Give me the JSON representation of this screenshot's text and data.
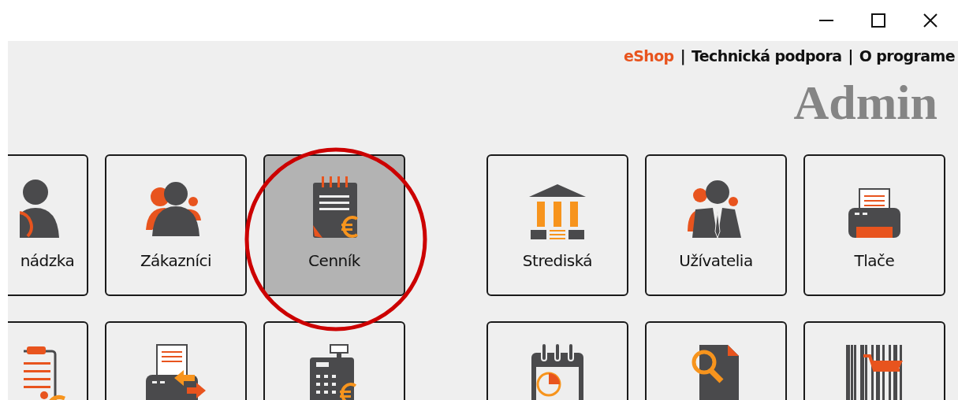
{
  "top_links": [
    {
      "label": "eShop",
      "kind": "accent"
    },
    {
      "label": "Technická podpora",
      "kind": "plain"
    },
    {
      "label": "O programe",
      "kind": "plain"
    }
  ],
  "separator": "|",
  "heading": "Admin",
  "tile_groups": [
    {
      "rows": [
        [
          {
            "label": "nádzka",
            "selected": false
          },
          {
            "label": "Zákazníci",
            "selected": false
          },
          {
            "label": "Cenník",
            "selected": true
          }
        ],
        [
          {
            "selected": false
          },
          {
            "selected": false
          },
          {
            "selected": false
          }
        ]
      ]
    },
    {
      "rows": [
        [
          {
            "label": "Strediská",
            "selected": false
          },
          {
            "label": "Užívatelia",
            "selected": false
          },
          {
            "label": "Tlače",
            "selected": false
          }
        ],
        [
          {
            "selected": false
          },
          {
            "selected": false
          },
          {
            "selected": false
          }
        ]
      ]
    }
  ]
}
